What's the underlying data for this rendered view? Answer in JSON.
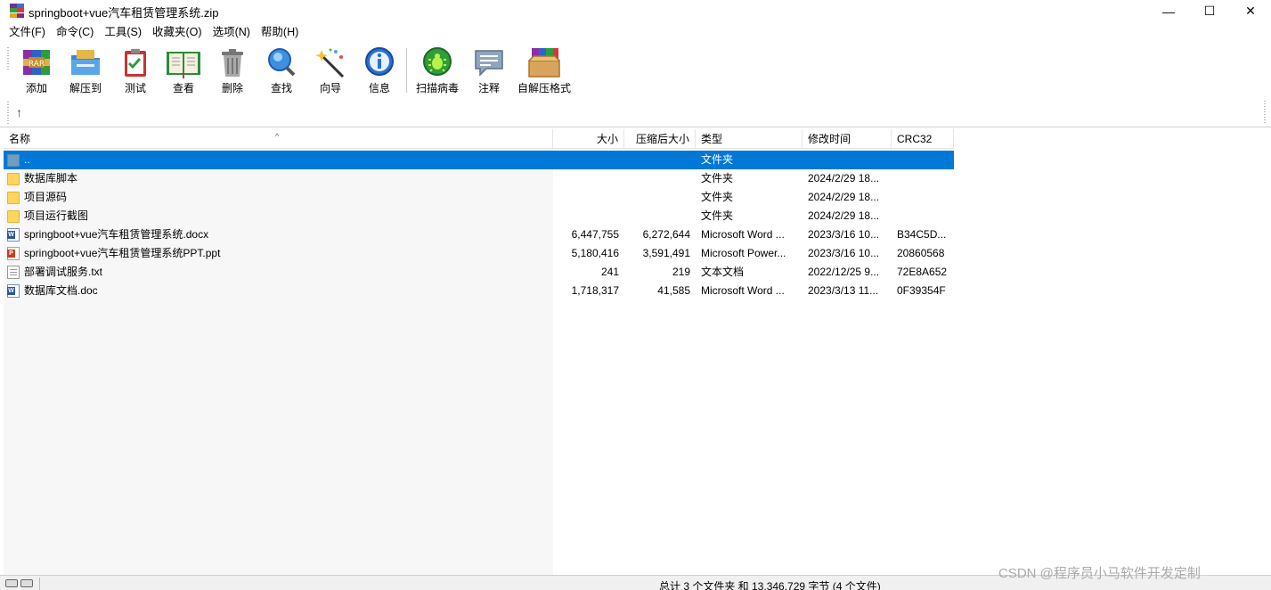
{
  "window": {
    "title": "springboot+vue汽车租赁管理系统.zip",
    "minimize": "—",
    "maximize": "☐",
    "close": "✕"
  },
  "menu": [
    {
      "label": "文件(F)"
    },
    {
      "label": "命令(C)"
    },
    {
      "label": "工具(S)"
    },
    {
      "label": "收藏夹(O)"
    },
    {
      "label": "选项(N)"
    },
    {
      "label": "帮助(H)"
    }
  ],
  "toolbar": [
    {
      "label": "添加",
      "icon": "add-archive-icon"
    },
    {
      "label": "解压到",
      "icon": "extract-to-icon"
    },
    {
      "label": "测试",
      "icon": "test-icon"
    },
    {
      "label": "查看",
      "icon": "view-book-icon"
    },
    {
      "label": "删除",
      "icon": "trash-icon"
    },
    {
      "label": "查找",
      "icon": "magnifier-icon"
    },
    {
      "label": "向导",
      "icon": "wizard-wand-icon"
    },
    {
      "label": "信息",
      "icon": "info-icon"
    },
    {
      "label": "扫描病毒",
      "icon": "virus-scan-icon"
    },
    {
      "label": "注释",
      "icon": "comment-icon"
    },
    {
      "label": "自解压格式",
      "icon": "sfx-icon"
    }
  ],
  "pathbar": {
    "up": "↑"
  },
  "columns": {
    "name": "名称",
    "size": "大小",
    "packed": "压缩后大小",
    "type": "类型",
    "modified": "修改时间",
    "crc": "CRC32"
  },
  "files": [
    {
      "name": "..",
      "size": "",
      "packed": "",
      "type": "文件夹",
      "modified": "",
      "crc": "",
      "kind": "updir",
      "selected": true
    },
    {
      "name": "数据库脚本",
      "size": "",
      "packed": "",
      "type": "文件夹",
      "modified": "2024/2/29 18...",
      "crc": "",
      "kind": "folder"
    },
    {
      "name": "项目源码",
      "size": "",
      "packed": "",
      "type": "文件夹",
      "modified": "2024/2/29 18...",
      "crc": "",
      "kind": "folder"
    },
    {
      "name": "项目运行截图",
      "size": "",
      "packed": "",
      "type": "文件夹",
      "modified": "2024/2/29 18...",
      "crc": "",
      "kind": "folder"
    },
    {
      "name": "springboot+vue汽车租赁管理系统.docx",
      "size": "6,447,755",
      "packed": "6,272,644",
      "type": "Microsoft Word ...",
      "modified": "2023/3/16 10...",
      "crc": "B34C5D...",
      "kind": "doc"
    },
    {
      "name": "springboot+vue汽车租赁管理系统PPT.ppt",
      "size": "5,180,416",
      "packed": "3,591,491",
      "type": "Microsoft Power...",
      "modified": "2023/3/16 10...",
      "crc": "20860568",
      "kind": "ppt"
    },
    {
      "name": "部署调试服务.txt",
      "size": "241",
      "packed": "219",
      "type": "文本文档",
      "modified": "2022/12/25 9...",
      "crc": "72E8A652",
      "kind": "txt"
    },
    {
      "name": "数据库文档.doc",
      "size": "1,718,317",
      "packed": "41,585",
      "type": "Microsoft Word ...",
      "modified": "2023/3/13 11...",
      "crc": "0F39354F",
      "kind": "doc"
    }
  ],
  "status": {
    "text": "总计 3 个文件夹 和 13,346,729 字节 (4 个文件)"
  },
  "watermark": "CSDN @程序员小马软件开发定制",
  "colors": {
    "selection": "#0078d7"
  }
}
